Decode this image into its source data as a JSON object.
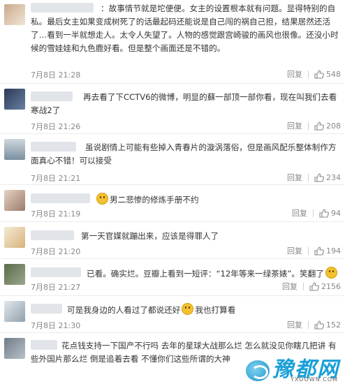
{
  "comments": [
    {
      "text": "：故事情节就是坨便便。女主的设置根本就有问题。显得特别的自私。最后女主如果变成树死了的话最起码还能说是自己闯的祸自己担，结果居然还活了…看到一半就想走人。太令人失望了。人物的感觉跟宫崎骏的画风也很像。还没小时候的雪娃娃和九色鹿好看。但是整个画面还是不错的。",
      "time": "7月8日 21:28",
      "reply": "回复",
      "likes": "548",
      "avatar_colors": [
        "#c9a98b",
        "#f1e6d8"
      ]
    },
    {
      "text": "再去看了下CCTV6的微博，明显的蘇一部顶一部你看，现在叫我们去看寒战2了",
      "time": "7月8日 21:26",
      "reply": "回复",
      "likes": "208",
      "avatar_colors": [
        "#2a3a55",
        "#6b7fa3"
      ]
    },
    {
      "text": "虽说剧情上可能有些掉入青春片的漩涡落俗，但是画风配乐整体制作方面真心不错！可以接受",
      "time": "7月8日 21:21",
      "reply": "回复",
      "likes": "234",
      "avatar_colors": [
        "#7a8fa0",
        "#cfd8de"
      ]
    },
    {
      "text": "男二悲惨的修炼手册不约",
      "time": "7月8日 21:19",
      "reply": "回复",
      "likes": "94",
      "avatar_colors": [
        "#e7d3c4",
        "#9a7b6a"
      ]
    },
    {
      "text": "第一天官媒就蹦出来，应该是得罪人了",
      "time": "7月8日 21:20",
      "reply": "回复",
      "likes": "194",
      "avatar_colors": [
        "#f2ead6",
        "#d9b27a"
      ]
    },
    {
      "text": "已看。确实烂。豆瓣上看到一短评：“12年等来一绿茶婊”。笑翻了",
      "time": "7月8日 21:27",
      "reply": "回复",
      "likes": "2156",
      "avatar_colors": [
        "#5b6a4a",
        "#9aa889"
      ]
    },
    {
      "text": "可是我身边的人看过了都说还好",
      "text_after": "我也打算看",
      "time": "7月8日 21:30",
      "reply": "回复",
      "likes": "152",
      "avatar_colors": [
        "#e3e8ec",
        "#8fa0ad"
      ]
    },
    {
      "text": "花点钱支持一下国产不行吗 去年的星球大战那么烂 怎么就没见你瞎几把讲 有些外国片那么烂 倒是追着去看 不懂你们这些所谓的大神",
      "avatar_colors": [
        "#6f7b86",
        "#b9c2ca"
      ]
    }
  ],
  "watermark": {
    "brand": "豫都网",
    "sub": "YXDOWN.COM"
  }
}
